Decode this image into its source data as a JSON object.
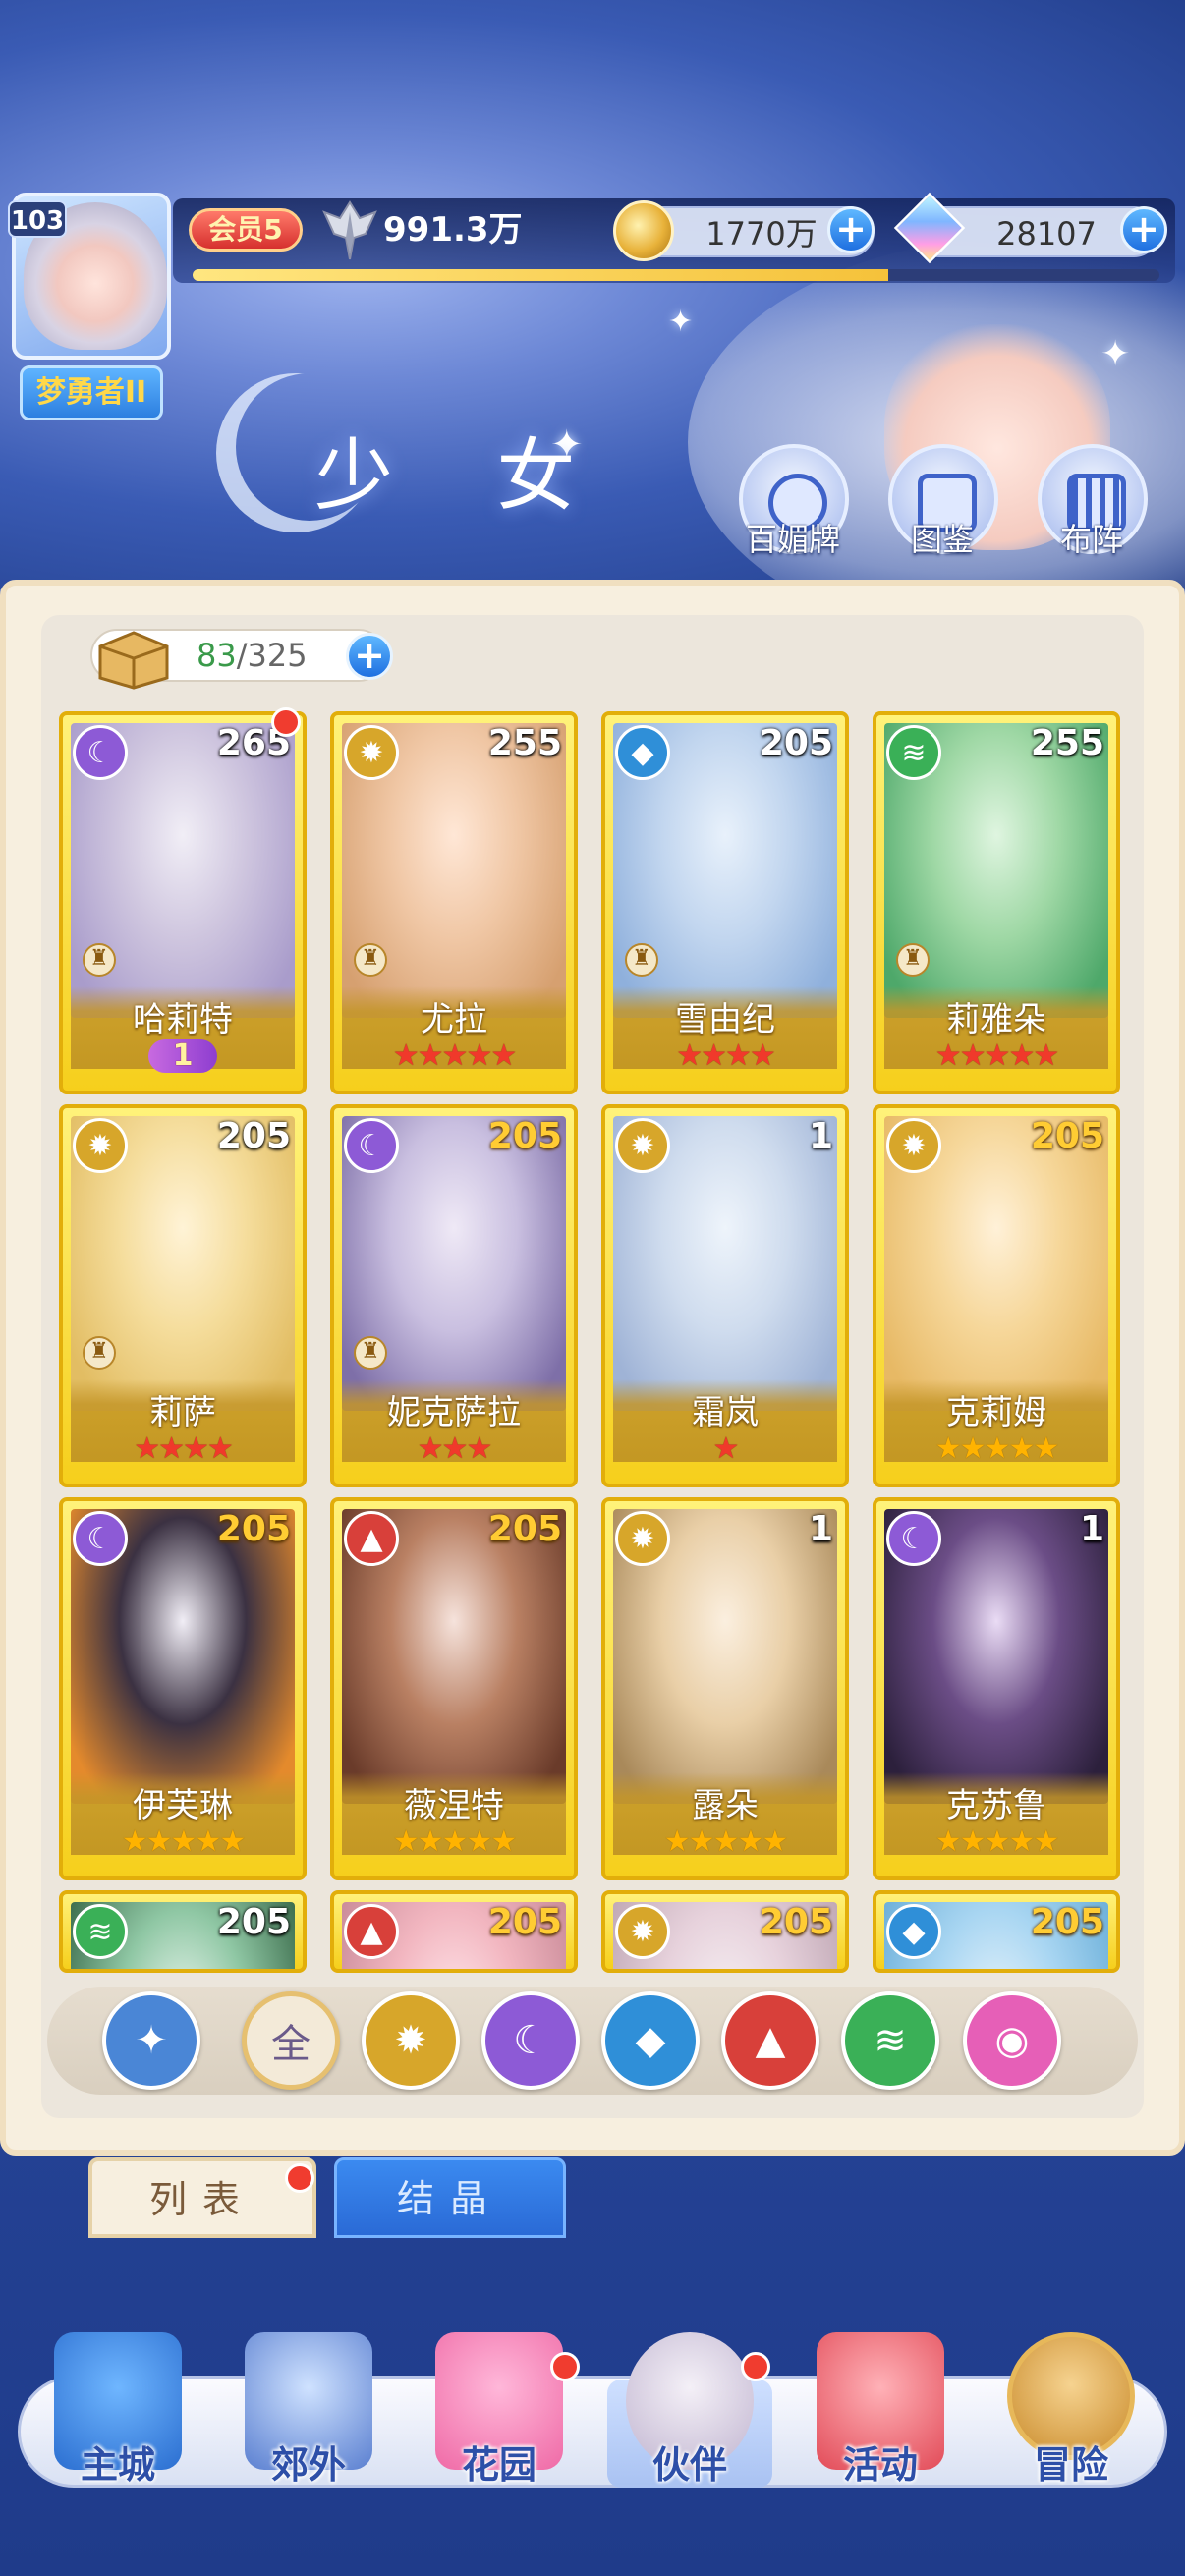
{
  "player": {
    "level": "103",
    "title": "梦勇者II"
  },
  "stats": {
    "vip": "会员5",
    "power": "991.3万",
    "gold": "1770万",
    "gems": "28107",
    "exp_fraction": 0.72
  },
  "header": {
    "title": "少 女"
  },
  "actions": [
    {
      "label": "百媚牌"
    },
    {
      "label": "图鉴"
    },
    {
      "label": "布阵"
    }
  ],
  "inventory": {
    "current": "83",
    "sep_max": "/325"
  },
  "cards": [
    {
      "name": "哈莉特",
      "level": "265",
      "element": "moon",
      "stars": 0,
      "star_color": "red",
      "stage": "1",
      "chess": true,
      "level_gold": false,
      "dot": true
    },
    {
      "name": "尤拉",
      "level": "255",
      "element": "light",
      "stars": 5,
      "star_color": "red",
      "chess": true,
      "level_gold": false
    },
    {
      "name": "雪由纪",
      "level": "205",
      "element": "water",
      "stars": 4,
      "star_color": "red",
      "chess": true,
      "level_gold": false
    },
    {
      "name": "莉雅朵",
      "level": "255",
      "element": "wind",
      "stars": 5,
      "star_color": "red",
      "chess": true,
      "level_gold": false
    },
    {
      "name": "莉萨",
      "level": "205",
      "element": "light",
      "stars": 4,
      "star_color": "red",
      "chess": true,
      "level_gold": false
    },
    {
      "name": "妮克萨拉",
      "level": "205",
      "element": "moon",
      "stars": 3,
      "star_color": "red",
      "chess": true,
      "level_gold": true
    },
    {
      "name": "霜岚",
      "level": "1",
      "element": "light",
      "stars": 1,
      "star_color": "red",
      "chess": false,
      "level_gold": false
    },
    {
      "name": "克莉姆",
      "level": "205",
      "element": "light",
      "stars": 5,
      "star_color": "gold",
      "chess": false,
      "level_gold": true
    },
    {
      "name": "伊芙琳",
      "level": "205",
      "element": "moon",
      "stars": 5,
      "star_color": "gold",
      "chess": false,
      "level_gold": true
    },
    {
      "name": "薇涅特",
      "level": "205",
      "element": "fire",
      "stars": 5,
      "star_color": "gold",
      "chess": false,
      "level_gold": true
    },
    {
      "name": "露朵",
      "level": "1",
      "element": "light",
      "stars": 5,
      "star_color": "gold",
      "chess": false,
      "level_gold": false
    },
    {
      "name": "克苏鲁",
      "level": "1",
      "element": "moon",
      "stars": 5,
      "star_color": "gold",
      "chess": false,
      "level_gold": false
    },
    {
      "name": "",
      "level": "205",
      "element": "wind",
      "stars": 0,
      "star_color": "gold",
      "chess": false,
      "level_gold": false
    },
    {
      "name": "",
      "level": "205",
      "element": "fire",
      "stars": 0,
      "star_color": "gold",
      "chess": false,
      "level_gold": true
    },
    {
      "name": "",
      "level": "205",
      "element": "light",
      "stars": 0,
      "star_color": "gold",
      "chess": false,
      "level_gold": true
    },
    {
      "name": "",
      "level": "205",
      "element": "water",
      "stars": 0,
      "star_color": "gold",
      "chess": false,
      "level_gold": true
    }
  ],
  "filters": [
    {
      "key": "up",
      "icon": "star-up-icon",
      "label": ""
    },
    {
      "key": "all",
      "icon": "all-icon",
      "label": "全"
    },
    {
      "key": "light",
      "icon": "sun-icon",
      "label": ""
    },
    {
      "key": "moon",
      "icon": "moon-icon",
      "label": ""
    },
    {
      "key": "water",
      "icon": "water-drop-icon",
      "label": ""
    },
    {
      "key": "fire",
      "icon": "fire-icon",
      "label": ""
    },
    {
      "key": "wind",
      "icon": "wind-icon",
      "label": ""
    },
    {
      "key": "pink",
      "icon": "orbit-icon",
      "label": ""
    }
  ],
  "tabs": [
    {
      "label": "列表"
    },
    {
      "label": "结晶"
    }
  ],
  "nav": [
    {
      "label": "主城"
    },
    {
      "label": "郊外"
    },
    {
      "label": "花园"
    },
    {
      "label": "伙伴"
    },
    {
      "label": "活动"
    },
    {
      "label": "冒险"
    }
  ],
  "colors": {
    "moon": "#8d5ad6",
    "light": "#d7a62a",
    "water": "#2f8fd8",
    "wind": "#3ab057",
    "fire": "#d8403a",
    "pink": "#e65fb7",
    "up": "#4a86d6",
    "all": "#f3ead8"
  }
}
